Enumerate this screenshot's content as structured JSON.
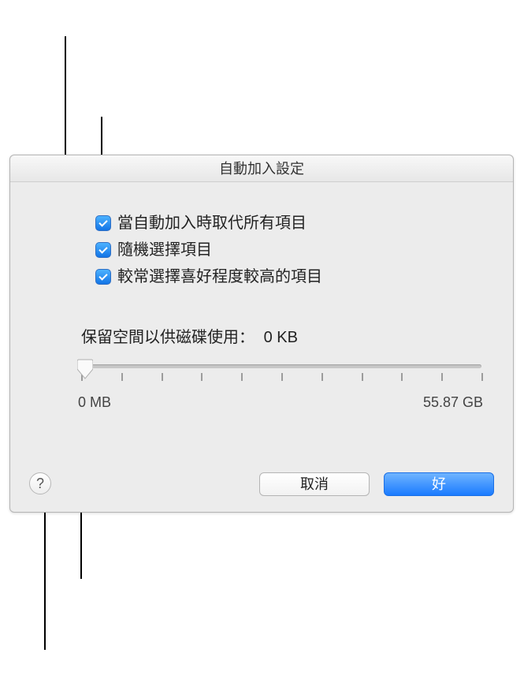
{
  "dialog": {
    "title": "自動加入設定",
    "checkboxes": [
      {
        "label": "當自動加入時取代所有項目",
        "checked": true
      },
      {
        "label": "隨機選擇項目",
        "checked": true
      },
      {
        "label": "較常選擇喜好程度較高的項目",
        "checked": true
      }
    ],
    "slider": {
      "label": "保留空間以供磁碟使用：",
      "value_display": "0 KB",
      "min_label": "0 MB",
      "max_label": "55.87 GB",
      "tick_count": 11
    },
    "buttons": {
      "cancel": "取消",
      "ok": "好"
    },
    "help": "?"
  }
}
